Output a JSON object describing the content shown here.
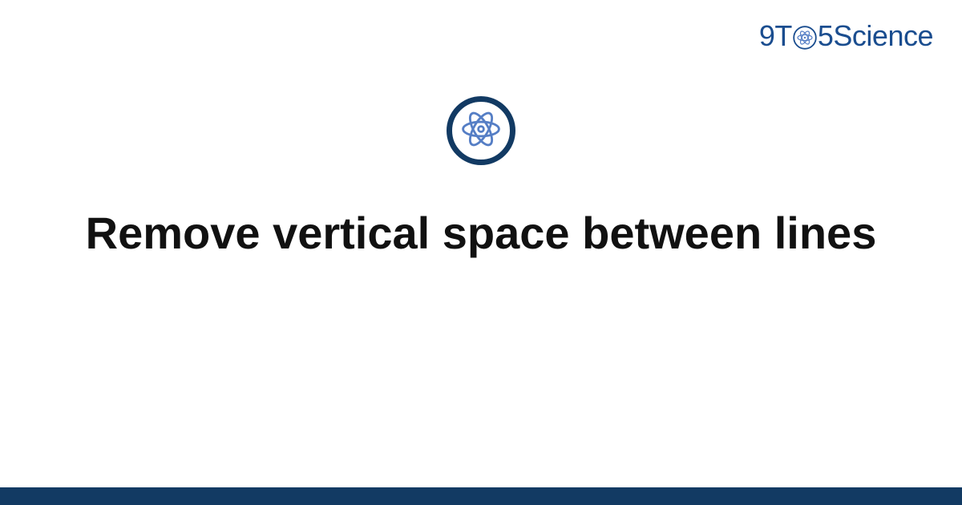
{
  "brand": {
    "pre": "9T",
    "post": "5Science",
    "icon_name": "atom-icon"
  },
  "hero": {
    "icon_name": "atom-icon"
  },
  "title": "Remove vertical space between lines",
  "colors": {
    "brand_text": "#1a4d8f",
    "ring": "#123a63",
    "atom": "#557ec5",
    "footer": "#123a63"
  }
}
